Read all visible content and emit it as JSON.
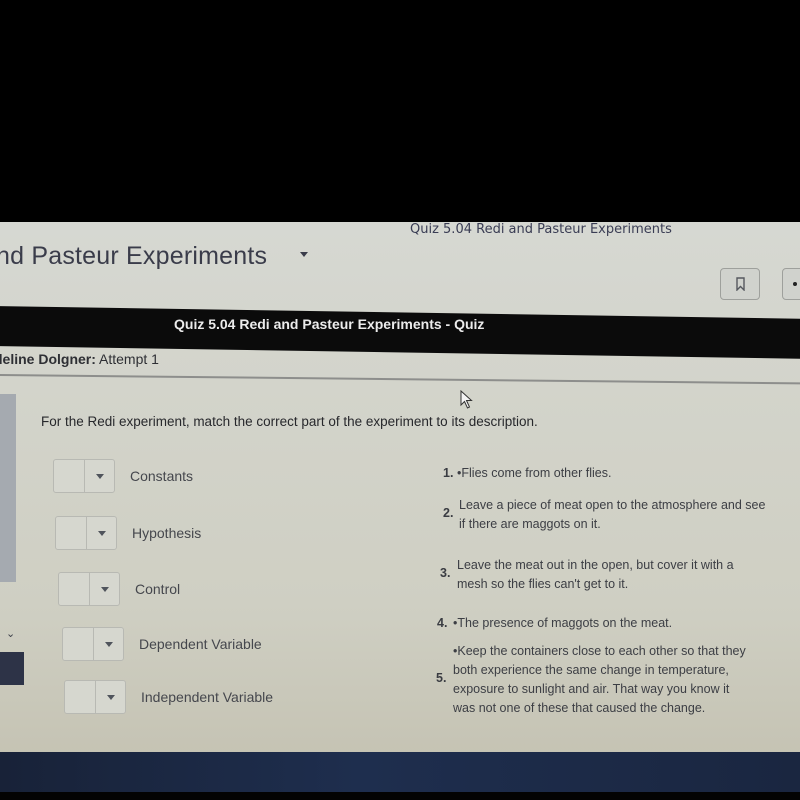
{
  "header": {
    "breadcrumb": "Quiz 5.04 Redi and Pasteur Experiments",
    "course_title": "nd Pasteur Experiments",
    "bookmark_icon": "bookmark-icon"
  },
  "quiz": {
    "title": "Quiz 5.04 Redi and Pasteur Experiments - Quiz",
    "student_name": "deline Dolgner:",
    "attempt": " Attempt 1"
  },
  "question": {
    "prompt": "For the Redi experiment, match the correct part of the experiment to its description.",
    "terms": [
      {
        "label": "Constants",
        "selected": ""
      },
      {
        "label": "Hypothesis",
        "selected": ""
      },
      {
        "label": "Control",
        "selected": ""
      },
      {
        "label": "Dependent Variable",
        "selected": ""
      },
      {
        "label": "Independent Variable",
        "selected": ""
      }
    ],
    "answers": [
      {
        "num": "1.",
        "lines": [
          "•Flies come from other flies."
        ]
      },
      {
        "num": "2.",
        "lines": [
          "Leave a piece of meat open to the atmosphere and see",
          "if there are maggots on it."
        ]
      },
      {
        "num": "3.",
        "lines": [
          "Leave the meat out in the open, but cover it with a",
          "mesh so the flies can't get to it."
        ]
      },
      {
        "num": "4.",
        "lines": [
          "•The presence of maggots on the meat."
        ]
      },
      {
        "num": "5.",
        "lines": [
          "•Keep the containers close to each other so that they",
          "both  experience the same change in temperature,",
          "exposure to sunlight and air.  That way you know it",
          "was not one of these that caused the change."
        ]
      }
    ]
  },
  "sidebar": {
    "chevron_icon": "chevron-down-icon"
  }
}
